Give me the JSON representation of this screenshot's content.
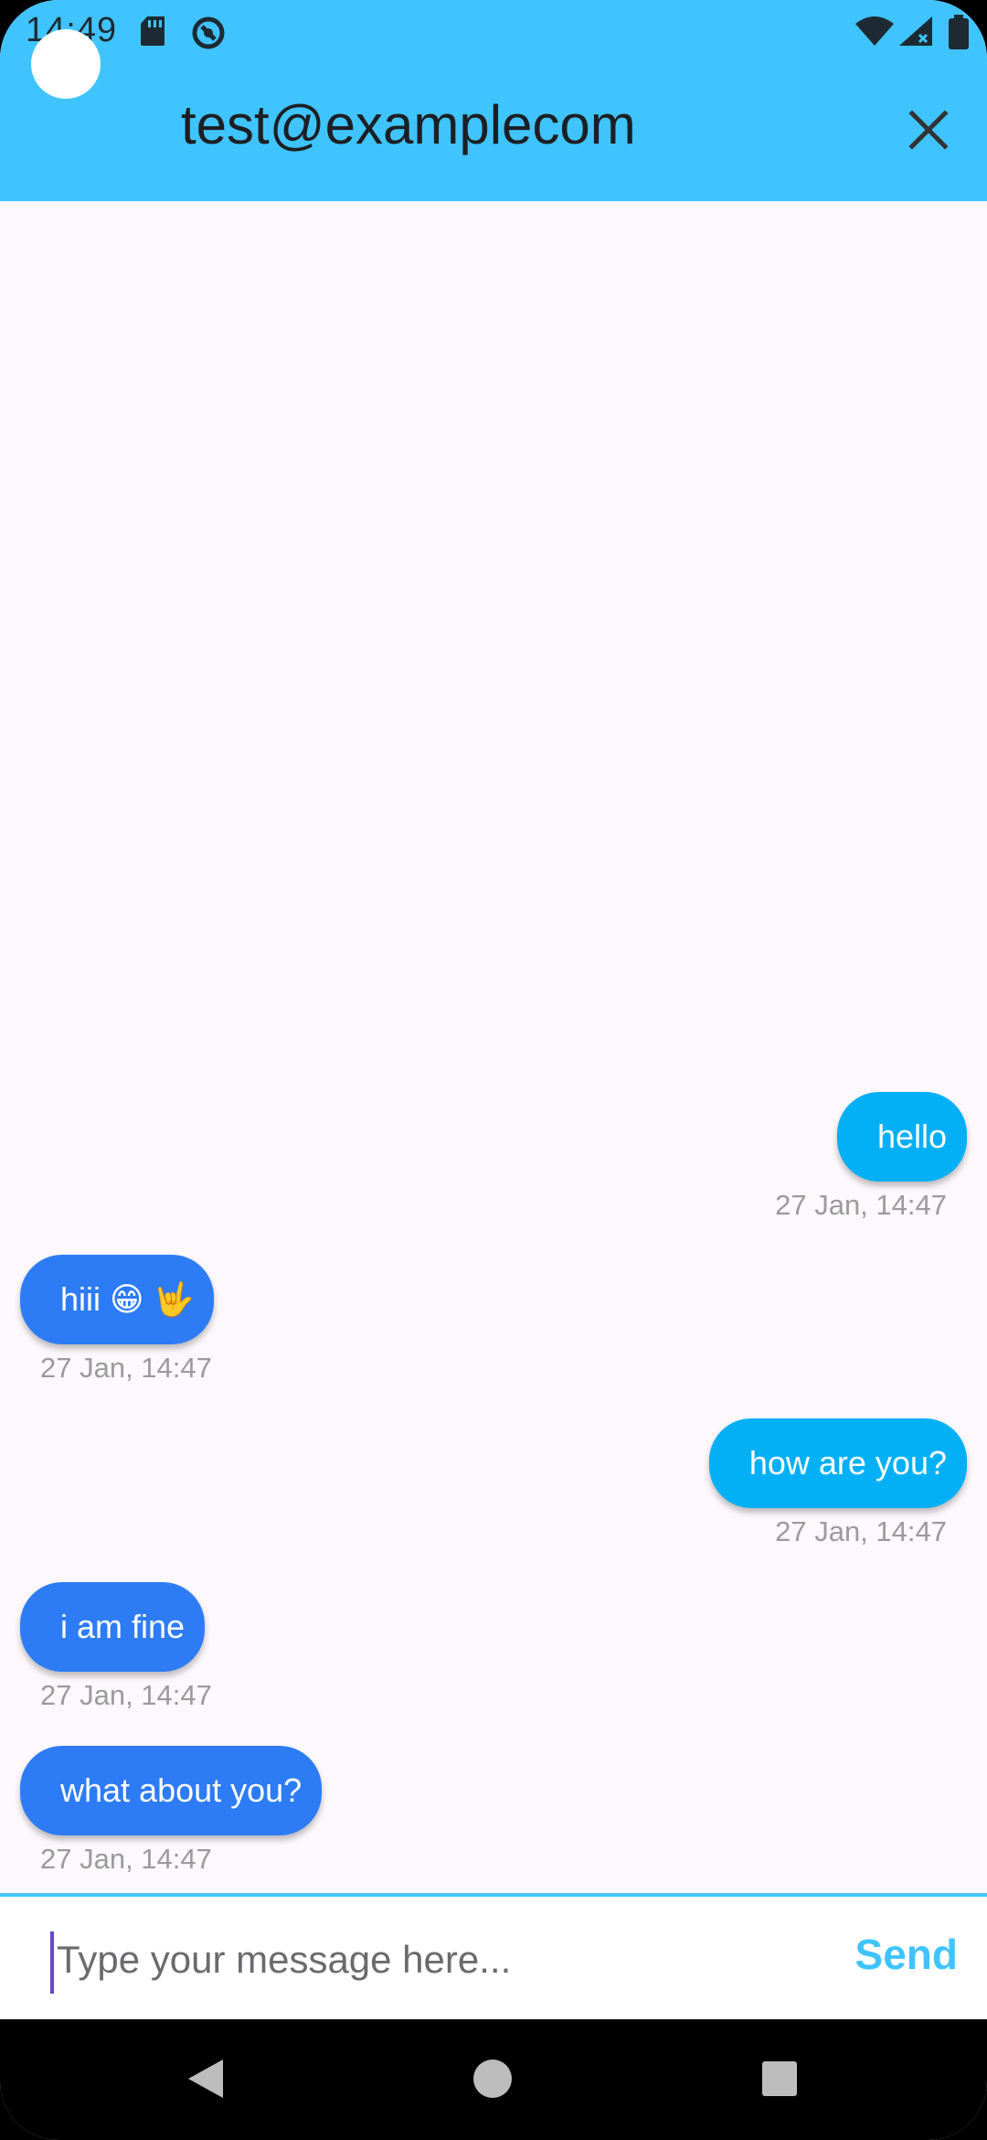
{
  "status_bar": {
    "time": "14:49",
    "icons": [
      "sd-card-icon",
      "sync-status-icon",
      "wifi-icon",
      "cell-signal-icon",
      "battery-icon"
    ]
  },
  "header": {
    "title": "test@examplecom",
    "close_icon": "close-icon",
    "background_color": "#40c4ff"
  },
  "messages": [
    {
      "direction": "sent",
      "text": "hello",
      "timestamp": "27 Jan, 14:47"
    },
    {
      "direction": "received",
      "text": "hiii 😁 🤟",
      "timestamp": "27 Jan, 14:47"
    },
    {
      "direction": "sent",
      "text": "how are you?",
      "timestamp": "27 Jan, 14:47"
    },
    {
      "direction": "received",
      "text": "i am fine",
      "timestamp": "27 Jan, 14:47"
    },
    {
      "direction": "received",
      "text": "what about you?",
      "timestamp": "27 Jan, 14:47"
    }
  ],
  "colors": {
    "sent_bubble": "#03b0f5",
    "received_bubble": "#2d7cf6",
    "accent": "#40c4ff"
  },
  "composer": {
    "placeholder": "Type your message here...",
    "value": "",
    "send_label": "Send"
  },
  "nav_bar": {
    "icons": [
      "back-icon",
      "home-icon",
      "recents-icon"
    ]
  }
}
